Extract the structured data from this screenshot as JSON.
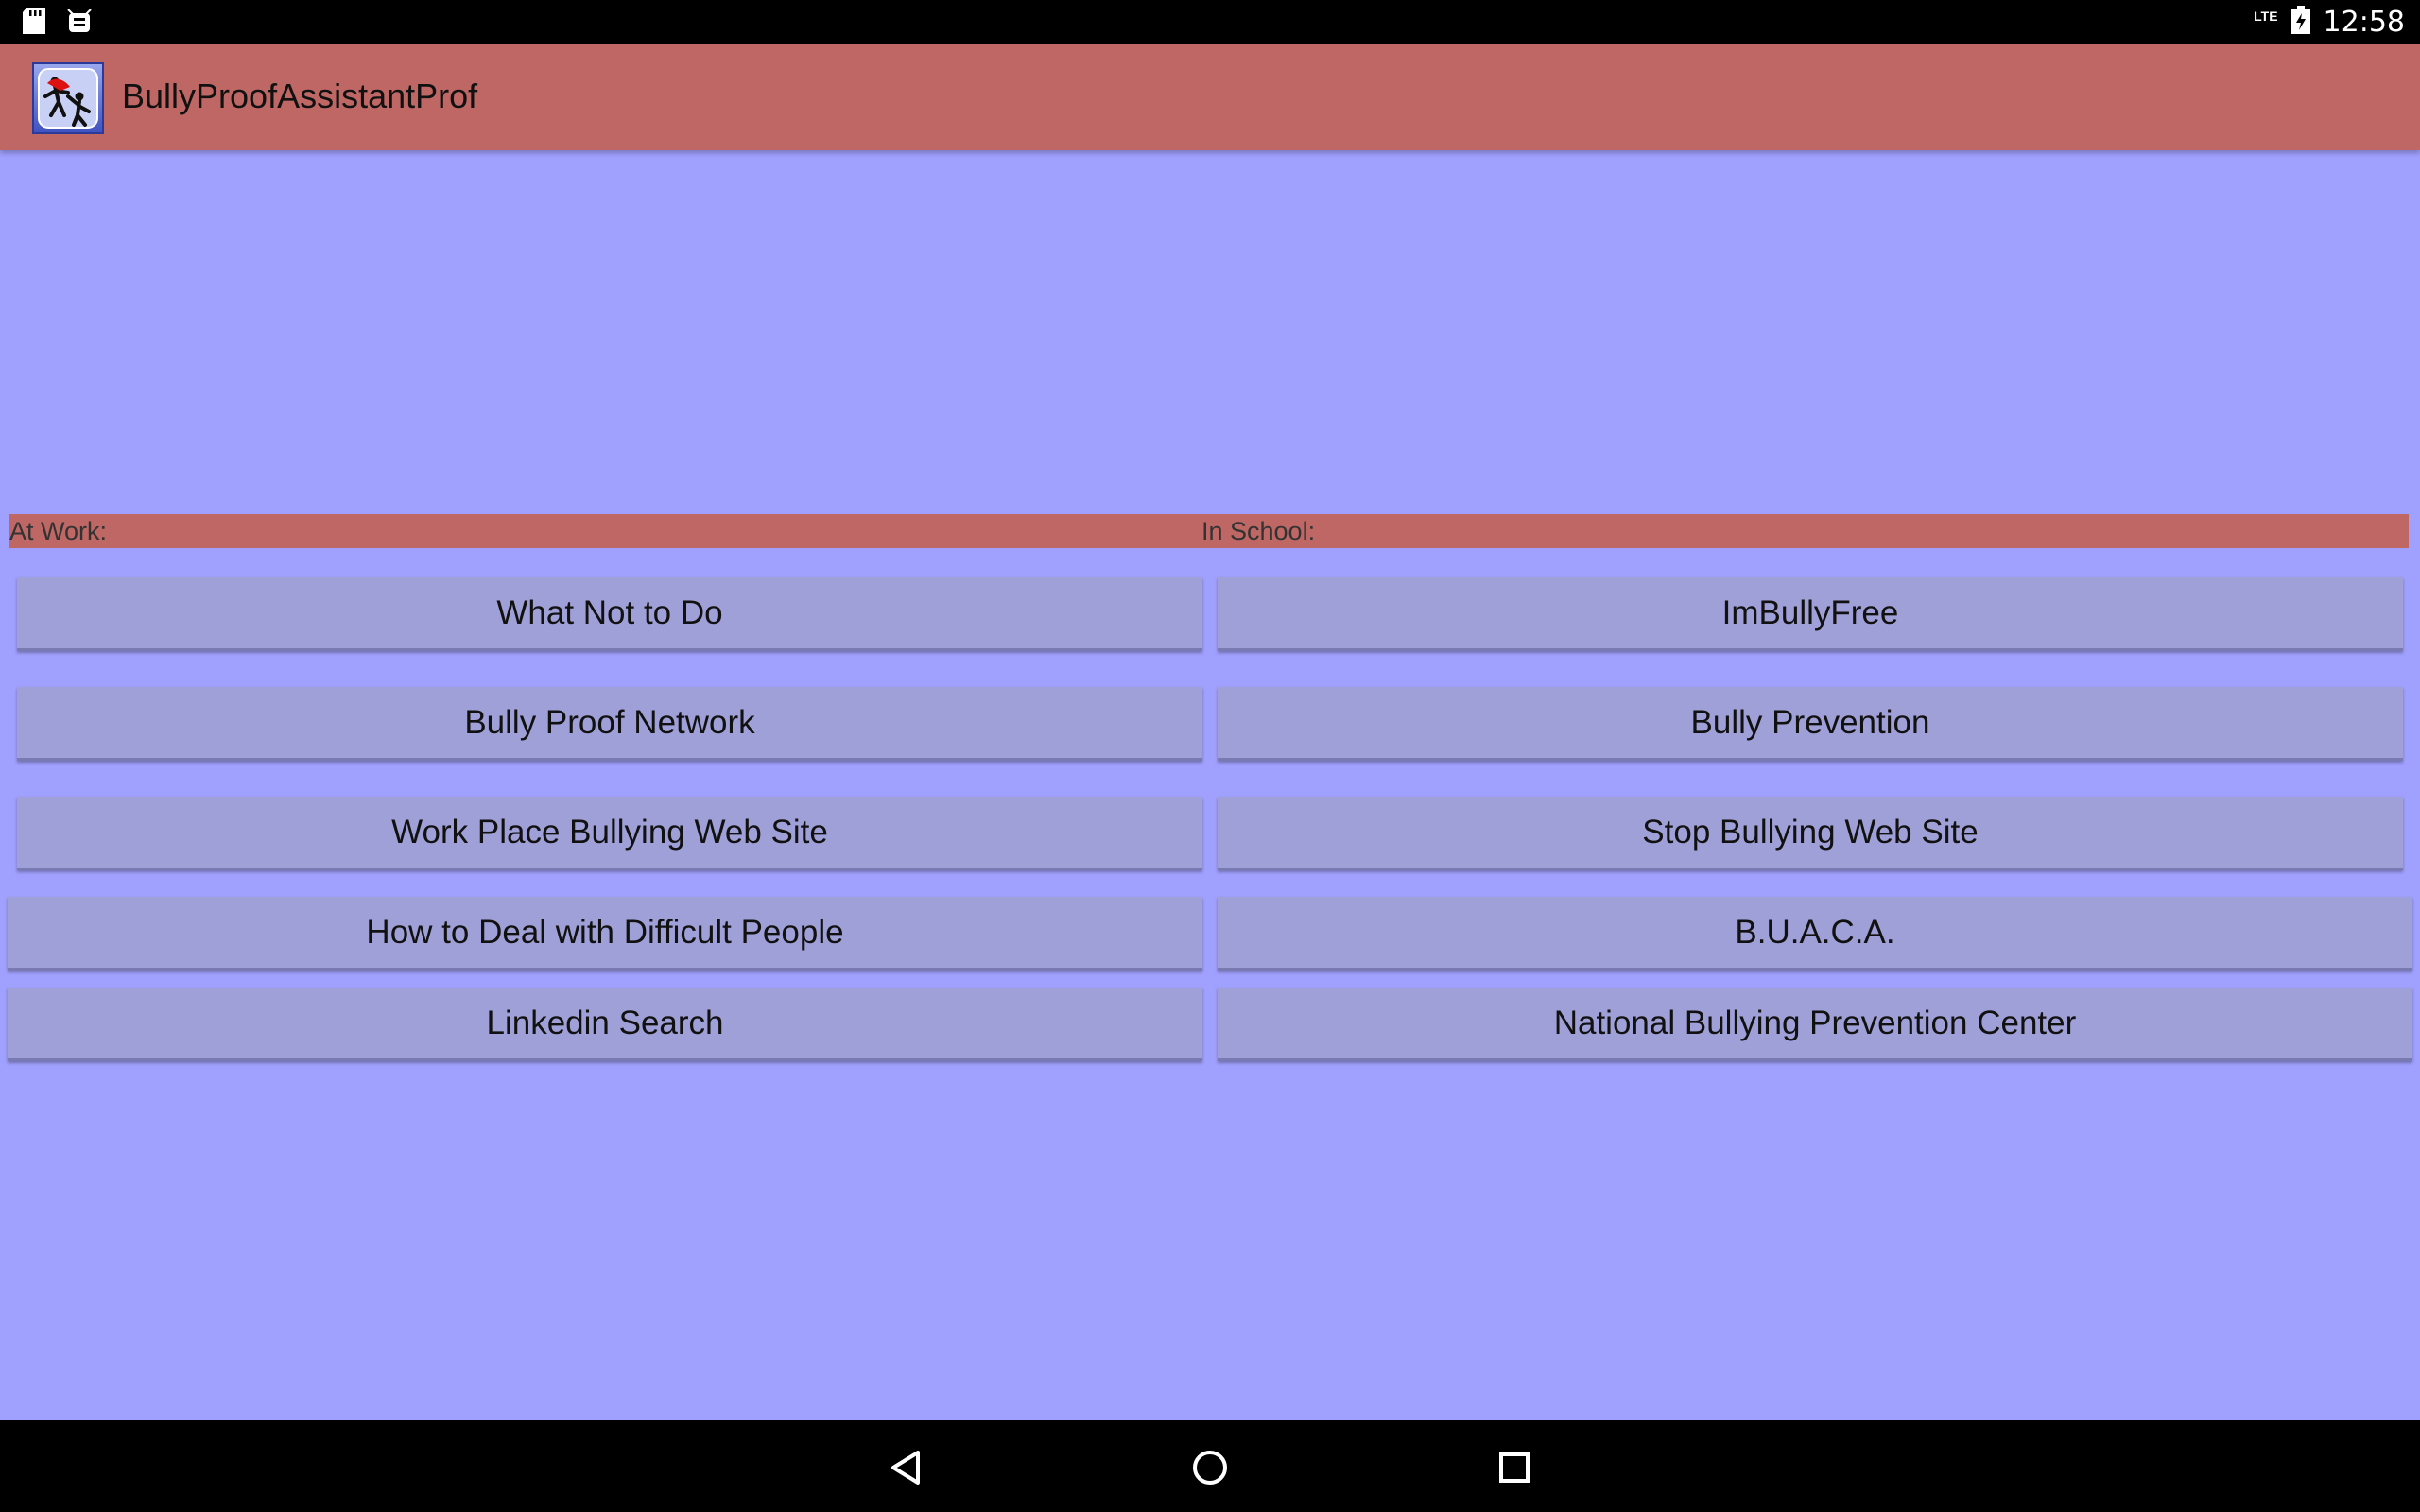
{
  "status_bar": {
    "network": "LTE",
    "time": "12:58",
    "icons": [
      "sd-card-icon",
      "android-debug-icon",
      "signal-icon",
      "battery-icon"
    ]
  },
  "app": {
    "title": "BullyProofAssistantProf",
    "icon": "app-logo-icon",
    "colors": {
      "background": "#a0a0fe",
      "accent": "#be6765",
      "button": "#a0a0d8"
    }
  },
  "sections": {
    "work_label": "At Work:",
    "school_label": "In School:"
  },
  "work_buttons": [
    {
      "label": "What Not to Do"
    },
    {
      "label": "Bully Proof Network"
    },
    {
      "label": "Work Place Bullying Web Site"
    },
    {
      "label": "How to Deal with Difficult People"
    },
    {
      "label": "Linkedin Search"
    }
  ],
  "school_buttons": [
    {
      "label": "ImBullyFree"
    },
    {
      "label": "Bully Prevention"
    },
    {
      "label": "Stop Bullying Web Site"
    },
    {
      "label": "B.U.A.C.A."
    },
    {
      "label": "National Bullying Prevention Center"
    }
  ],
  "nav_bar": {
    "icons": [
      "back-icon",
      "home-icon",
      "recents-icon"
    ]
  }
}
